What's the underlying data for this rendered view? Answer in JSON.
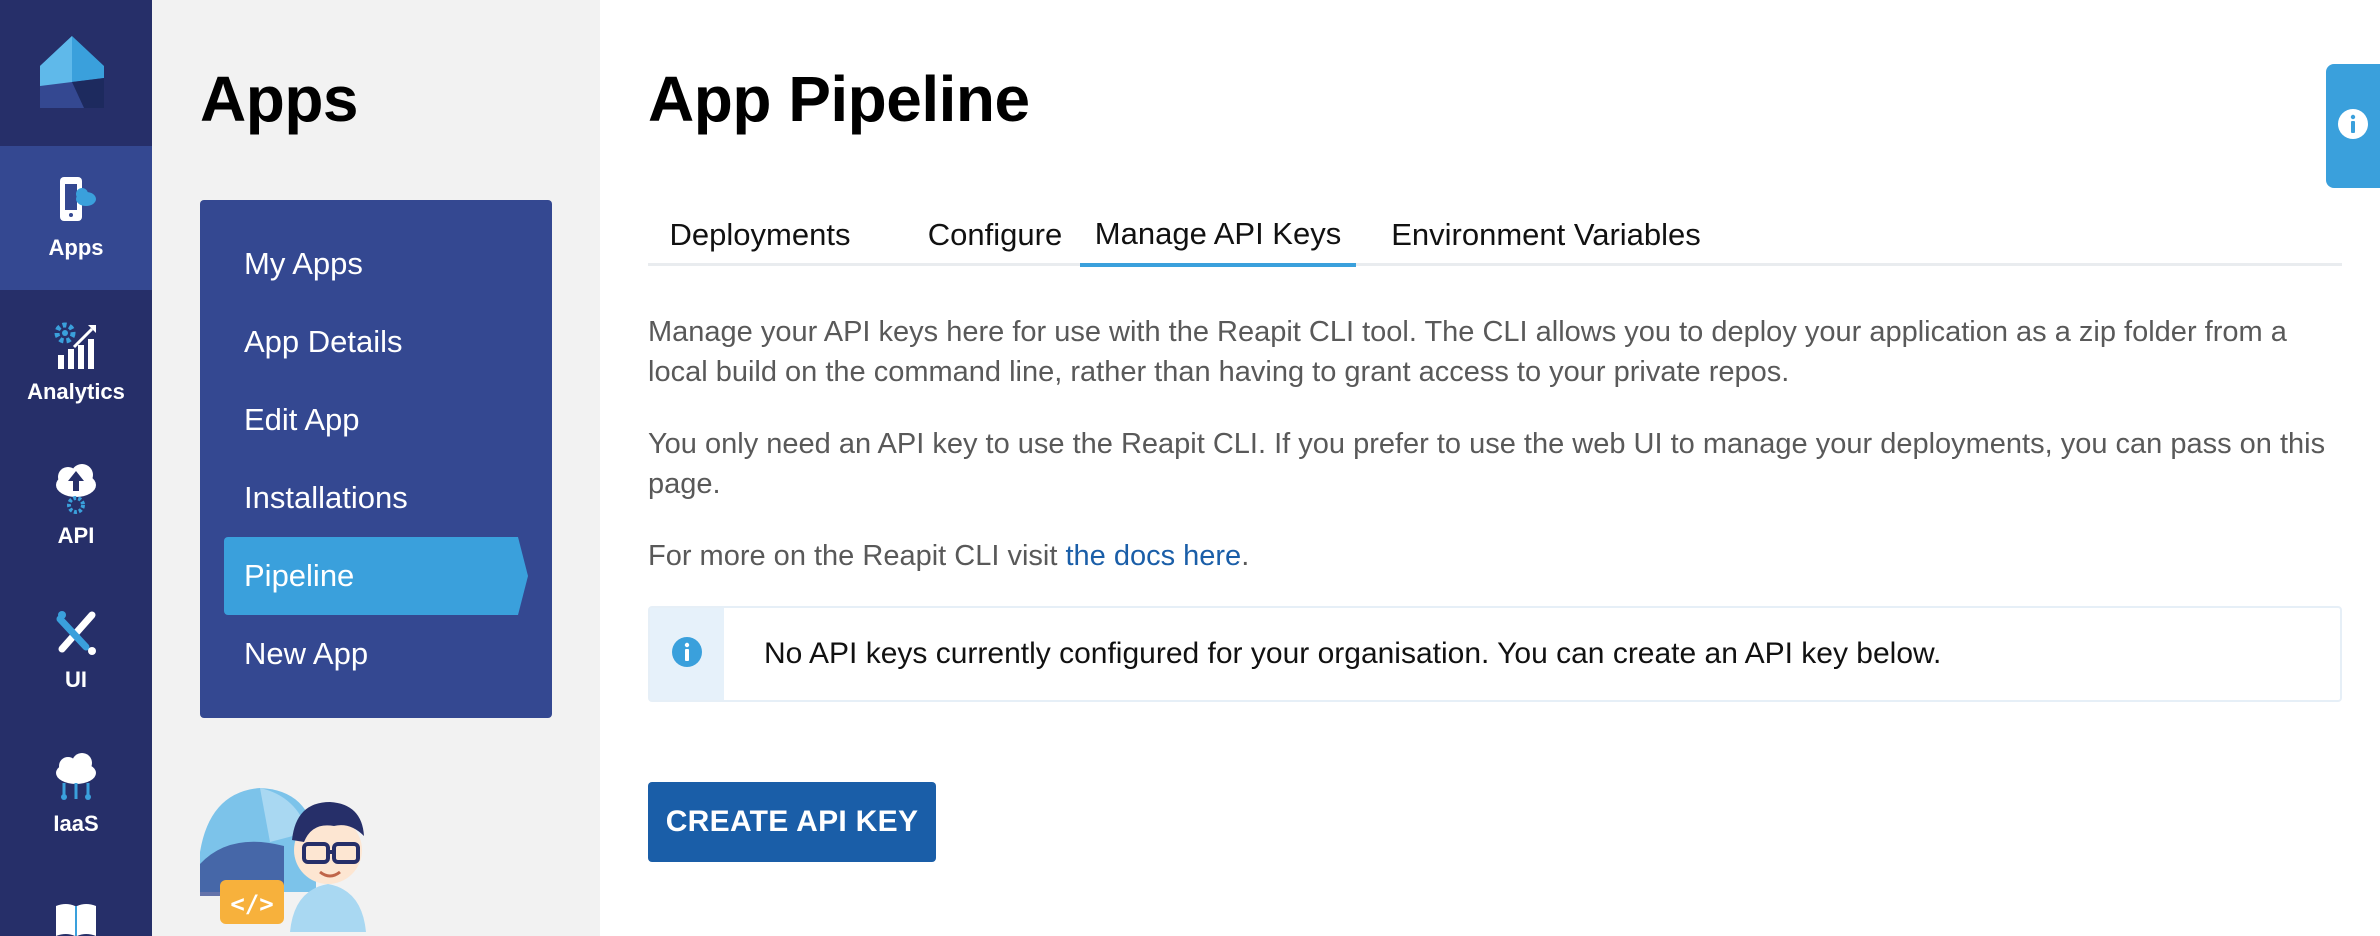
{
  "nav": {
    "items": [
      {
        "label": "Apps",
        "icon": "apps-icon"
      },
      {
        "label": "Analytics",
        "icon": "analytics-icon"
      },
      {
        "label": "API",
        "icon": "api-icon"
      },
      {
        "label": "UI",
        "icon": "ui-icon"
      },
      {
        "label": "IaaS",
        "icon": "iaas-icon"
      },
      {
        "label": "",
        "icon": "book-icon"
      }
    ]
  },
  "sidebar": {
    "title": "Apps",
    "items": [
      {
        "label": "My Apps"
      },
      {
        "label": "App Details"
      },
      {
        "label": "Edit App"
      },
      {
        "label": "Installations"
      },
      {
        "label": "Pipeline"
      },
      {
        "label": "New App"
      }
    ]
  },
  "main": {
    "title": "App Pipeline",
    "tabs": [
      {
        "label": "Deployments"
      },
      {
        "label": "Configure"
      },
      {
        "label": "Manage API Keys"
      },
      {
        "label": "Environment Variables"
      }
    ],
    "paragraph1": "Manage your API keys here for use with the Reapit CLI tool. The CLI allows you to deploy your application as a zip folder from a local build on the command line, rather than having to grant access to your private repos.",
    "paragraph2": "You only need an API key to use the Reapit CLI. If you prefer to use the web UI to manage your deployments, you can pass on this page.",
    "paragraph3_prefix": "For more on the Reapit CLI visit ",
    "paragraph3_link": "the docs here",
    "paragraph3_suffix": ".",
    "callout_text": "No API keys currently configured for your organisation. You can create an API key below.",
    "create_button": "CREATE API KEY"
  },
  "colors": {
    "nav_bg": "#262f69",
    "nav_active": "#344891",
    "accent": "#3aa0dc",
    "primary_button": "#1a5ea8",
    "link": "#1a5ea8",
    "text_muted": "#595959"
  }
}
